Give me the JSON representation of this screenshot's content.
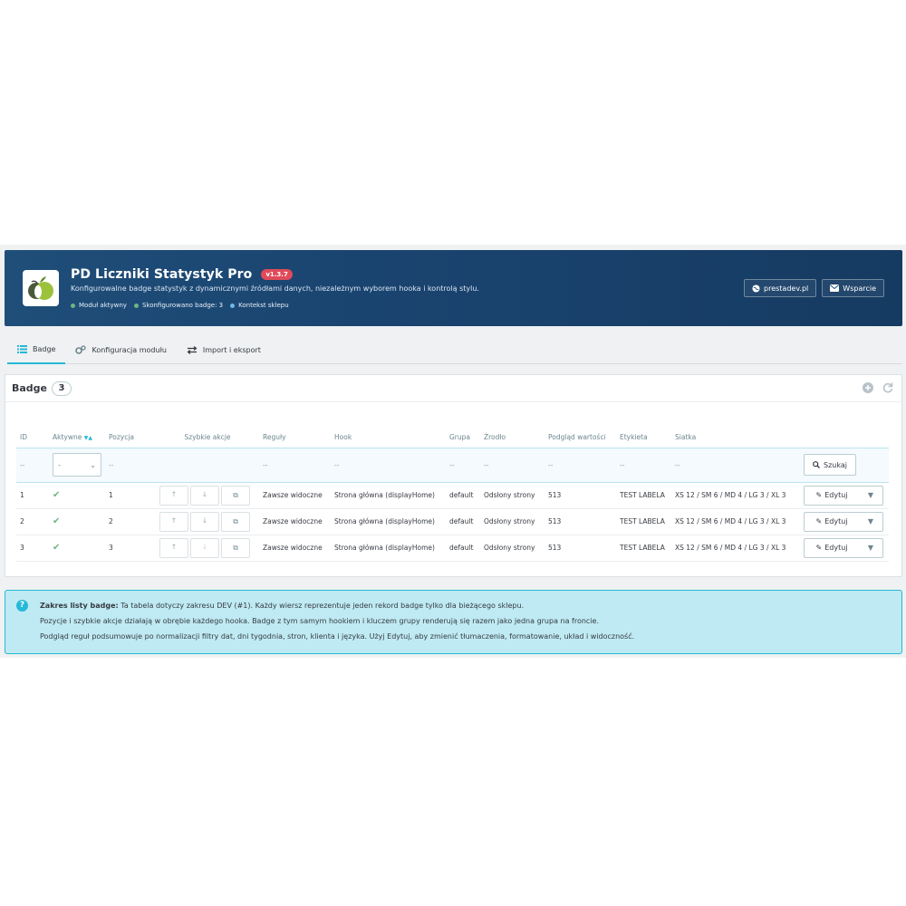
{
  "header": {
    "title": "PD Liczniki Statystyk Pro",
    "version": "v1.3.7",
    "subtitle": "Konfigurowalne badge statystyk z dynamicznymi źródłami danych, niezależnym wyborem hooka i kontrolą stylu.",
    "statuses": [
      {
        "label": "Moduł aktywny",
        "color": "#70b580"
      },
      {
        "label": "Skonfigurowano badge: 3",
        "color": "#70b580"
      },
      {
        "label": "Kontekst sklepu",
        "color": "#6fb9e8"
      }
    ],
    "buttons": {
      "site": "prestadev.pl",
      "support": "Wsparcie"
    }
  },
  "tabs": [
    {
      "label": "Badge",
      "icon": "list-icon",
      "active": true
    },
    {
      "label": "Konfiguracja modułu",
      "icon": "cogs-icon",
      "active": false
    },
    {
      "label": "Import i eksport",
      "icon": "exchange-icon",
      "active": false
    }
  ],
  "panel": {
    "title": "Badge",
    "count": "3"
  },
  "table": {
    "headers": [
      "ID",
      "Aktywne",
      "Pozycja",
      "Szybkie akcje",
      "Reguły",
      "Hook",
      "Grupa",
      "Źrodło",
      "Podgląd wartości",
      "Etykieta",
      "Siatka"
    ],
    "filter": {
      "placeholder": "--",
      "select_value": "-",
      "search_label": "Szukaj"
    },
    "rows": [
      {
        "id": "1",
        "position": "1",
        "rules": "Zawsze widoczne",
        "hook": "Strona główna (displayHome)",
        "group": "default",
        "source": "Odsłony strony",
        "preview": "513",
        "label": "TEST LABELA",
        "grid": "XS 12 / SM 6 / MD 4 / LG 3 / XL 3",
        "edit": "Edytuj"
      },
      {
        "id": "2",
        "position": "2",
        "rules": "Zawsze widoczne",
        "hook": "Strona główna (displayHome)",
        "group": "default",
        "source": "Odsłony strony",
        "preview": "513",
        "label": "TEST LABELA",
        "grid": "XS 12 / SM 6 / MD 4 / LG 3 / XL 3",
        "edit": "Edytuj"
      },
      {
        "id": "3",
        "position": "3",
        "rules": "Zawsze widoczne",
        "hook": "Strona główna (displayHome)",
        "group": "default",
        "source": "Odsłony strony",
        "preview": "513",
        "label": "TEST LABELA",
        "grid": "XS 12 / SM 6 / MD 4 / LG 3 / XL 3",
        "edit": "Edytuj"
      }
    ]
  },
  "info": {
    "lead": "Zakres listy badge:",
    "line1": " Ta tabela dotyczy zakresu DEV (#1). Każdy wiersz reprezentuje jeden rekord badge tylko dla bieżącego sklepu.",
    "line2": "Pozycje i szybkie akcje działają w obrębie każdego hooka. Badge z tym samym hookiem i kluczem grupy renderują się razem jako jedna grupa na froncie.",
    "line3": "Podgląd reguł podsumowuje po normalizacji filtry dat, dni tygodnia, stron, klienta i języka. Użyj Edytuj, aby zmienić tłumaczenia, formatowanie, układ i widoczność."
  },
  "colors": {
    "accent": "#25b9d7",
    "header_bg": "#1f4e79",
    "success": "#70b580",
    "version_badge": "#e04a59"
  }
}
